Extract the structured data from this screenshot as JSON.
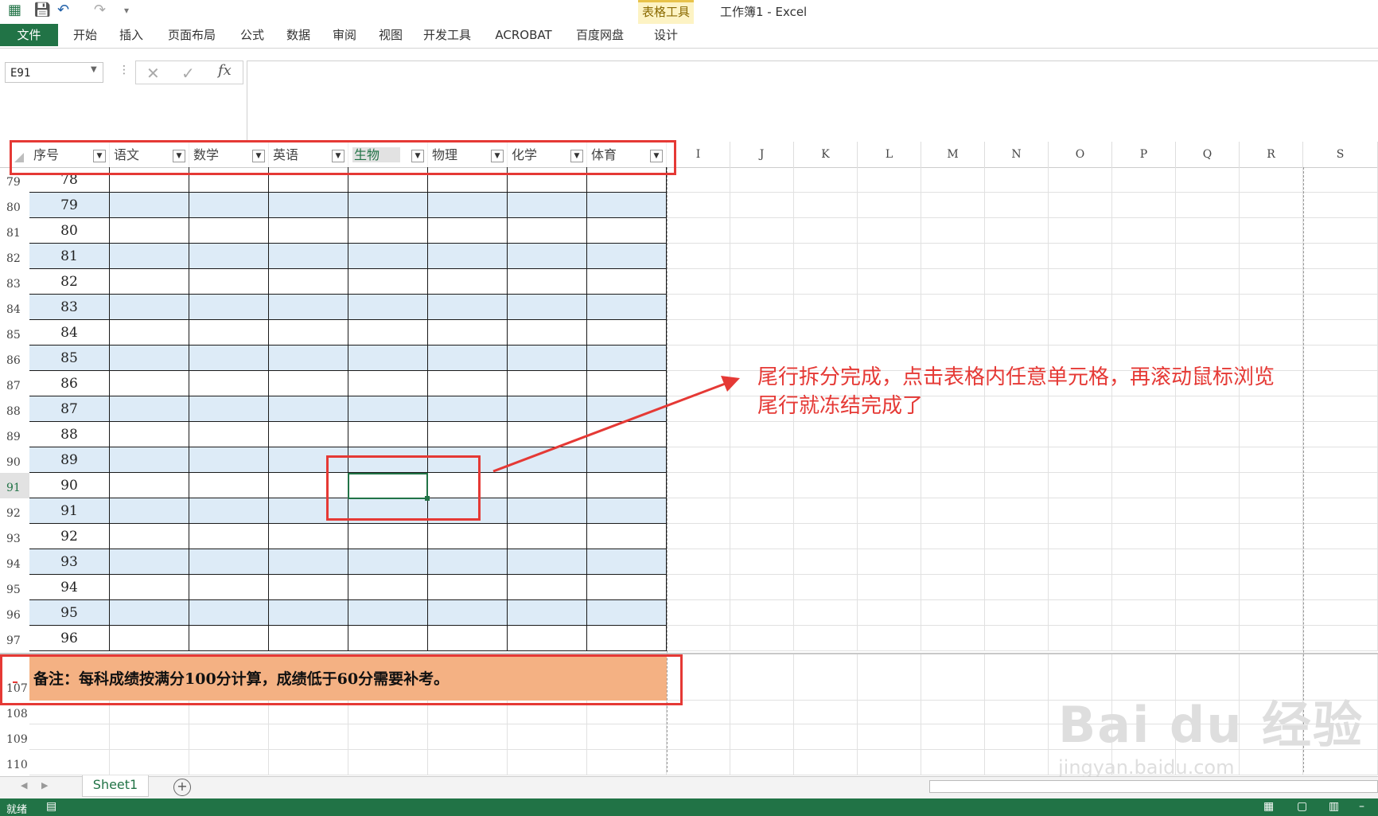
{
  "app": {
    "window_title": "工作簿1 - Excel",
    "context_group": "表格工具"
  },
  "ribbon": {
    "file_tab": "文件",
    "tabs": [
      "开始",
      "插入",
      "页面布局",
      "公式",
      "数据",
      "审阅",
      "视图",
      "开发工具",
      "ACROBAT",
      "百度网盘",
      "设计"
    ]
  },
  "formula_bar": {
    "name_box": "E91",
    "fx": "fx",
    "cancel": "✕",
    "enter": "✓"
  },
  "table": {
    "headers": [
      "序号",
      "语文",
      "数学",
      "英语",
      "生物",
      "物理",
      "化学",
      "体育"
    ],
    "other_columns": [
      "I",
      "J",
      "K",
      "L",
      "M",
      "N",
      "O",
      "P",
      "Q",
      "R",
      "S"
    ],
    "rows": [
      {
        "rownum": "79",
        "seq": "78"
      },
      {
        "rownum": "80",
        "seq": "79"
      },
      {
        "rownum": "81",
        "seq": "80"
      },
      {
        "rownum": "82",
        "seq": "81"
      },
      {
        "rownum": "83",
        "seq": "82"
      },
      {
        "rownum": "84",
        "seq": "83"
      },
      {
        "rownum": "85",
        "seq": "84"
      },
      {
        "rownum": "86",
        "seq": "85"
      },
      {
        "rownum": "87",
        "seq": "86"
      },
      {
        "rownum": "88",
        "seq": "87"
      },
      {
        "rownum": "89",
        "seq": "88"
      },
      {
        "rownum": "90",
        "seq": "89"
      },
      {
        "rownum": "91",
        "seq": "90"
      },
      {
        "rownum": "92",
        "seq": "91"
      },
      {
        "rownum": "93",
        "seq": "92"
      },
      {
        "rownum": "94",
        "seq": "93"
      },
      {
        "rownum": "95",
        "seq": "94"
      },
      {
        "rownum": "96",
        "seq": "95"
      },
      {
        "rownum": "97",
        "seq": "96"
      }
    ],
    "note_rownum": "107",
    "note_text": "备注：每科成绩按满分100分计算，成绩低于60分需要补考。",
    "empty_rows": [
      "108",
      "109",
      "110"
    ]
  },
  "annotation": {
    "line1": "尾行拆分完成，点击表格内任意单元格，再滚动鼠标浏览",
    "line2": "尾行就冻结完成了"
  },
  "sheets": {
    "active": "Sheet1",
    "add": "+"
  },
  "status": {
    "ready": "就绪"
  },
  "watermark": {
    "brand": "Bai du 经验",
    "url": "jingyan.baidu.com"
  },
  "colors": {
    "excel_green": "#217346",
    "band": "#ddebf7",
    "note_fill": "#f4b183",
    "annotation_red": "#e53935"
  }
}
